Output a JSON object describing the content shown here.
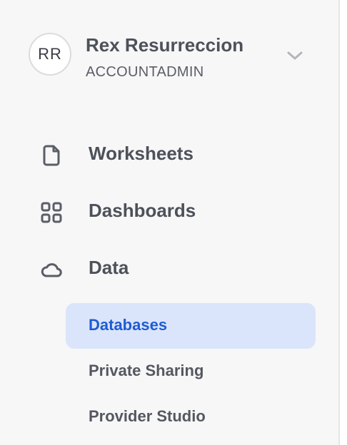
{
  "account": {
    "initials": "RR",
    "name": "Rex Resurreccion",
    "role": "ACCOUNTADMIN"
  },
  "nav": {
    "worksheets": "Worksheets",
    "dashboards": "Dashboards",
    "data": "Data"
  },
  "data_submenu": {
    "databases": "Databases",
    "private_sharing": "Private Sharing",
    "provider_studio": "Provider Studio",
    "active": "Databases"
  },
  "colors": {
    "active_bg": "#dae5fb",
    "active_text": "#1f5bd1",
    "sidebar_bg": "#f7f7f8"
  }
}
